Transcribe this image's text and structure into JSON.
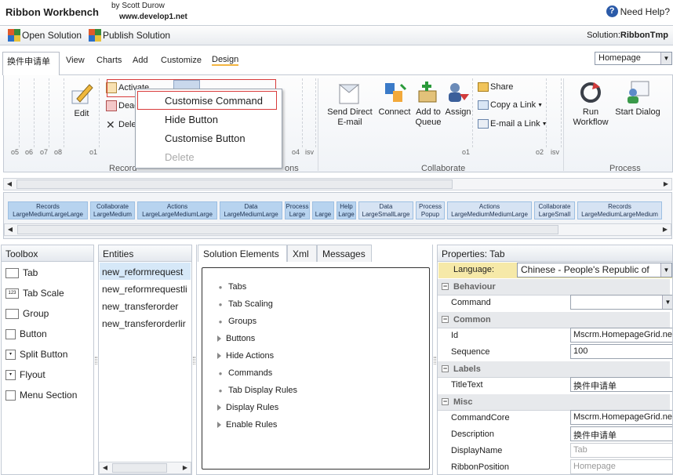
{
  "app": {
    "title": "Ribbon Workbench",
    "byline": "by Scott Durow",
    "site": "www.develop1.net",
    "help": "Need Help?"
  },
  "toolbar": {
    "open_solution": "Open Solution",
    "publish_solution": "Publish Solution",
    "solution_prefix": "Solution:",
    "solution_name": "RibbonTmp"
  },
  "tabs": {
    "active": "换件申请单",
    "items": [
      "View",
      "Charts",
      "Add",
      "Customize",
      "Design"
    ],
    "homepage": "Homepage"
  },
  "ribbon": {
    "record_buttons": {
      "edit": "Edit",
      "activate": "Activate",
      "deactivate": "Deac",
      "delete": "Dele"
    },
    "collab_buttons": {
      "send_direct_email": "Send Direct\nE-mail",
      "connect": "Connect",
      "add_to_queue": "Add to\nQueue",
      "assign": "Assign",
      "share": "Share",
      "copy_link": "Copy a Link",
      "email_link": "E-mail a Link"
    },
    "process_buttons": {
      "run_workflow": "Run\nWorkflow",
      "start_dialog": "Start Dialog"
    },
    "groups": {
      "records": "Record",
      "collaborate": "Collaborate",
      "process": "Process",
      "actions_partial": "ons"
    },
    "ticks": [
      "o5",
      "o6",
      "o7",
      "o8",
      "o1",
      "o4",
      "isv",
      "o1",
      "o2",
      "isv"
    ]
  },
  "context_menu": {
    "items": [
      "Customise Command",
      "Hide Button",
      "Customise Button",
      "Delete"
    ]
  },
  "overview": [
    {
      "top": "Records",
      "bottom": "LargeMediumLargeLarge"
    },
    {
      "top": "Collaborate",
      "bottom": "LargeMedium"
    },
    {
      "top": "Actions",
      "bottom": "LargeLargeMediumLarge"
    },
    {
      "top": "Data",
      "bottom": "LargeMediumLarge"
    },
    {
      "top": "Process",
      "bottom": "Large"
    },
    {
      "top": "",
      "bottom": "Large"
    },
    {
      "top": "Help",
      "bottom": "Large"
    },
    {
      "top": "Data",
      "bottom": "LargeSmallLarge"
    },
    {
      "top": "Process",
      "bottom": "Popup"
    },
    {
      "top": "Actions",
      "bottom": "LargeMediumMediumLarge"
    },
    {
      "top": "Collaborate",
      "bottom": "LargeSmall"
    },
    {
      "top": "Records",
      "bottom": "LargeMediumLargeMedium"
    }
  ],
  "toolbox": {
    "title": "Toolbox",
    "items": [
      "Tab",
      "Tab Scale",
      "Group",
      "Button",
      "Split Button",
      "Flyout",
      "Menu Section"
    ]
  },
  "entities": {
    "title": "Entities",
    "items": [
      "new_reformrequest",
      "new_reformrequestli",
      "new_transferorder",
      "new_transferorderlir"
    ]
  },
  "solution": {
    "tabs": [
      "Solution Elements",
      "Xml",
      "Messages"
    ],
    "items": [
      "Tabs",
      "Tab Scaling",
      "Groups",
      "Buttons",
      "Hide Actions",
      "Commands",
      "Tab Display Rules",
      "Display Rules",
      "Enable Rules"
    ]
  },
  "properties": {
    "title": "Properties: Tab",
    "language_label": "Language:",
    "language_value": "Chinese - People's Republic of",
    "sections": {
      "behaviour": "Behaviour",
      "common": "Common",
      "labels": "Labels",
      "misc": "Misc"
    },
    "fields": {
      "command": {
        "label": "Command",
        "value": ""
      },
      "id": {
        "label": "Id",
        "value": "Mscrm.HomepageGrid.nev"
      },
      "sequence": {
        "label": "Sequence",
        "value": "100"
      },
      "titletext": {
        "label": "TitleText",
        "value": "换件申请单"
      },
      "commandcore": {
        "label": "CommandCore",
        "value": "Mscrm.HomepageGrid.nev"
      },
      "description": {
        "label": "Description",
        "value": "换件申请单"
      },
      "displayname": {
        "label": "DisplayName",
        "value": "Tab"
      },
      "ribbonposition": {
        "label": "RibbonPosition",
        "value": "Homepage"
      }
    }
  }
}
